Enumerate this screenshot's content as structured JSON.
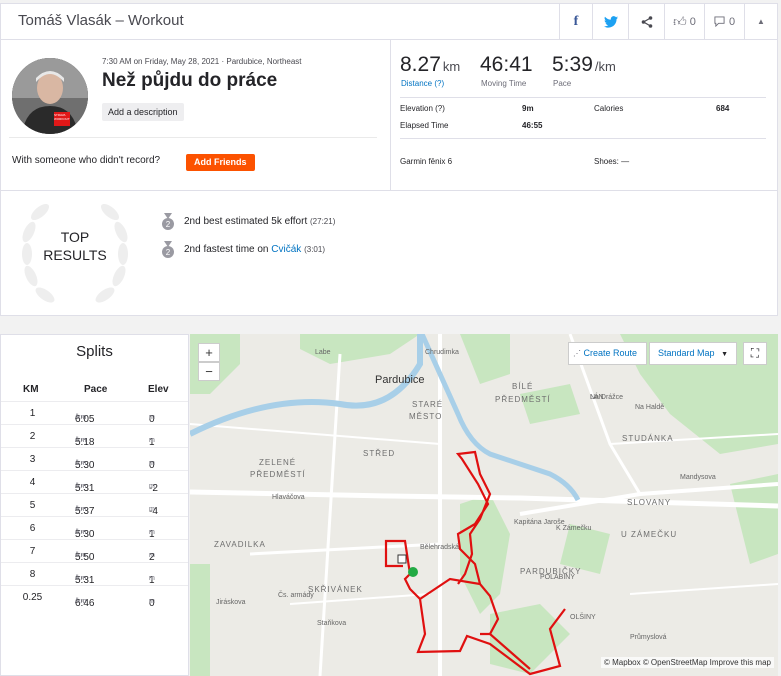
{
  "header": {
    "title": "Tomáš Vlasák – Workout",
    "kudos_count": "0",
    "comment_count": "0"
  },
  "activity": {
    "datetime": "7:30 AM on Friday, May 28, 2021 · Pardubice, Northeast",
    "title": "Než půjdu do práce",
    "add_description": "Add a description",
    "friends_prompt": "With someone who didn't record?",
    "add_friends": "Add Friends",
    "avatar_caption": "STRAVA WORKOUT"
  },
  "stats": {
    "distance": {
      "value": "8.27",
      "unit": "km",
      "label": "Distance (?)"
    },
    "moving_time": {
      "value": "46:41",
      "label": "Moving Time"
    },
    "pace": {
      "value": "5:39",
      "unit": "/km",
      "label": "Pace"
    },
    "elevation": {
      "label": "Elevation (?)",
      "value": "9m"
    },
    "calories": {
      "label": "Calories",
      "value": "684"
    },
    "elapsed": {
      "label": "Elapsed Time",
      "value": "46:55"
    },
    "device": "Garmin fēnix 6",
    "shoes": "Shoes: —"
  },
  "top_results": {
    "badge": [
      "TOP",
      "RESULTS"
    ],
    "items": [
      {
        "text": "2nd best estimated 5k effort",
        "detail": "(27:21)",
        "rank": "2"
      },
      {
        "prefix": "2nd fastest time on",
        "segment": "Cvičák",
        "detail": "(3:01)",
        "rank": "2"
      }
    ]
  },
  "splits": {
    "title": "Splits",
    "headers": [
      "KM",
      "Pace",
      "Elev"
    ],
    "pace_unit": "/km",
    "elev_unit": "m",
    "rows": [
      {
        "km": "1",
        "pace": "6:05",
        "elev": "0"
      },
      {
        "km": "2",
        "pace": "5:18",
        "elev": "1"
      },
      {
        "km": "3",
        "pace": "5:30",
        "elev": "0"
      },
      {
        "km": "4",
        "pace": "5:31",
        "elev": "-2"
      },
      {
        "km": "5",
        "pace": "5:37",
        "elev": "-4"
      },
      {
        "km": "6",
        "pace": "5:30",
        "elev": "1"
      },
      {
        "km": "7",
        "pace": "5:50",
        "elev": "2"
      },
      {
        "km": "8",
        "pace": "5:31",
        "elev": "1"
      },
      {
        "km": "0.25",
        "pace": "6:46",
        "elev": "0"
      }
    ]
  },
  "map": {
    "create_route": "Create Route",
    "style": "Standard Map",
    "zoom_in": "+",
    "zoom_out": "−",
    "attribution": "© Mapbox © OpenStreetMap Improve this map",
    "labels": [
      "Pardubice",
      "STARÉ",
      "MĚSTO",
      "BÍLÉ",
      "PŘEDMĚSTÍ",
      "STŘED",
      "ZELENÉ",
      "PŘEDMĚSTÍ",
      "POLABINY",
      "ZAVADILKA",
      "SKŘIVÁNEK",
      "PARDUBIČKY",
      "STUDÁNKA",
      "SLOVANY",
      "U ZÁMEČKU",
      "LÁN",
      "OLŠINY",
      "Hlaváčova",
      "Kapitána Jaroše",
      "K Zámečku",
      "Na Drážce",
      "Na Haldě",
      "Mandysova",
      "Staňkova",
      "Labe",
      "Chrudimka",
      "Jiráskova",
      "Čs. armády",
      "Průmyslová",
      "Bělehradská"
    ],
    "route_color": "#e01010"
  }
}
